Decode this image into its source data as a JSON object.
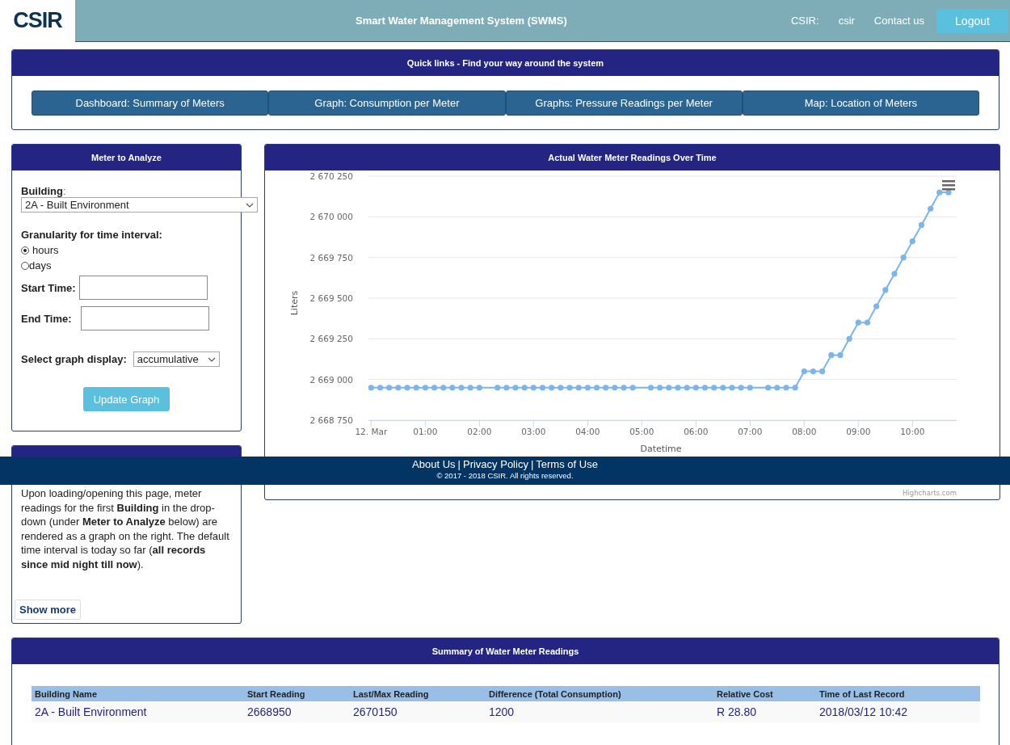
{
  "header": {
    "logo": "CSIR",
    "title": "Smart Water Management System (SWMS)",
    "org_label": "CSIR:",
    "user": "csir",
    "contact": "Contact us",
    "logout": "Logout"
  },
  "quick_links": {
    "title": "Quick links - Find your way around the system",
    "links": [
      "Dashboard: Summary of Meters",
      "Graph: Consumption per Meter",
      "Graphs: Pressure Readings per Meter",
      "Map: Location of Meters"
    ]
  },
  "meter_panel": {
    "title": "Meter to Analyze",
    "building_label": "Building",
    "building_colon": ":",
    "building_value": "2A - Built Environment",
    "granularity_label": "Granularity for time interval:",
    "granularity_options": [
      {
        "label": "hours",
        "selected": true
      },
      {
        "label": "days",
        "selected": false
      }
    ],
    "start_label": "Start Time:",
    "end_label": "End Time:",
    "display_label": "Select graph display:",
    "display_value": "accumulative",
    "update_button": "Update Graph"
  },
  "description_panel": {
    "text": "Upon loading/opening this page, meter readings for the first **Building** in the drop-down (under **Meter to Analyze** below) are rendered as a graph on the right. The default time interval is today so far (**all records since mid night till now**).",
    "show_more": "Show more"
  },
  "chart_panel": {
    "title": "Actual Water Meter Readings Over Time",
    "credit": "Highcharts.com",
    "chart_data": {
      "type": "line",
      "grid": true,
      "xlabel": "Datetime",
      "ylabel": "Liters",
      "xlim": [
        -3,
        649
      ],
      "ylim": [
        2668750,
        2670250
      ],
      "xticks": [
        {
          "value": 0,
          "label": "12. Mar"
        },
        {
          "value": 60,
          "label": "01:00"
        },
        {
          "value": 120,
          "label": "02:00"
        },
        {
          "value": 180,
          "label": "03:00"
        },
        {
          "value": 240,
          "label": "04:00"
        },
        {
          "value": 300,
          "label": "05:00"
        },
        {
          "value": 360,
          "label": "06:00"
        },
        {
          "value": 420,
          "label": "07:00"
        },
        {
          "value": 480,
          "label": "08:00"
        },
        {
          "value": 540,
          "label": "09:00"
        },
        {
          "value": 600,
          "label": "10:00"
        }
      ],
      "yticks": [
        {
          "value": 2668750,
          "label": "2 668 750"
        },
        {
          "value": 2669000,
          "label": "2 669 000"
        },
        {
          "value": 2669250,
          "label": "2 669 250"
        },
        {
          "value": 2669500,
          "label": "2 669 500"
        },
        {
          "value": 2669750,
          "label": "2 669 750"
        },
        {
          "value": 2670000,
          "label": "2 670 000"
        },
        {
          "value": 2670250,
          "label": "2 670 250"
        }
      ],
      "x": [
        0,
        10,
        20,
        30,
        40,
        50,
        60,
        70,
        80,
        90,
        100,
        110,
        120,
        140,
        150,
        160,
        170,
        180,
        190,
        200,
        210,
        220,
        230,
        240,
        250,
        260,
        270,
        280,
        290,
        310,
        320,
        330,
        340,
        350,
        360,
        370,
        380,
        390,
        400,
        410,
        420,
        440,
        450,
        460,
        470,
        480,
        490,
        500,
        510,
        520,
        530,
        540,
        550,
        560,
        570,
        580,
        590,
        600,
        610,
        620,
        630,
        640
      ],
      "series": [
        {
          "color": "#7cb5ec",
          "marker": true,
          "values": [
            2668950,
            2668950,
            2668950,
            2668950,
            2668950,
            2668950,
            2668950,
            2668950,
            2668950,
            2668950,
            2668950,
            2668950,
            2668950,
            2668950,
            2668950,
            2668950,
            2668950,
            2668950,
            2668950,
            2668950,
            2668950,
            2668950,
            2668950,
            2668950,
            2668950,
            2668950,
            2668950,
            2668950,
            2668950,
            2668950,
            2668950,
            2668950,
            2668950,
            2668950,
            2668950,
            2668950,
            2668950,
            2668950,
            2668950,
            2668950,
            2668950,
            2668950,
            2668950,
            2668950,
            2668950,
            2669050,
            2669050,
            2669050,
            2669150,
            2669150,
            2669250,
            2669350,
            2669350,
            2669450,
            2669550,
            2669650,
            2669750,
            2669850,
            2669950,
            2670050,
            2670150,
            2670150
          ]
        }
      ]
    }
  },
  "summary": {
    "title": "Summary of Water Meter Readings",
    "columns": [
      "Building Name",
      "Start Reading",
      "Last/Max Reading",
      "Difference (Total Consumption)",
      "Relative Cost",
      "Time of Last Record"
    ],
    "rows": [
      [
        "2A - Built Environment",
        "2668950",
        "2670150",
        "1200",
        "R 28.80",
        "2018/03/12 10:42"
      ]
    ]
  },
  "footer": {
    "links": [
      "About Us",
      "Privacy Policy",
      "Terms of Use"
    ],
    "separator": "|",
    "copyright": "© 2017 - 2018 CSIR. All rights reserved."
  }
}
